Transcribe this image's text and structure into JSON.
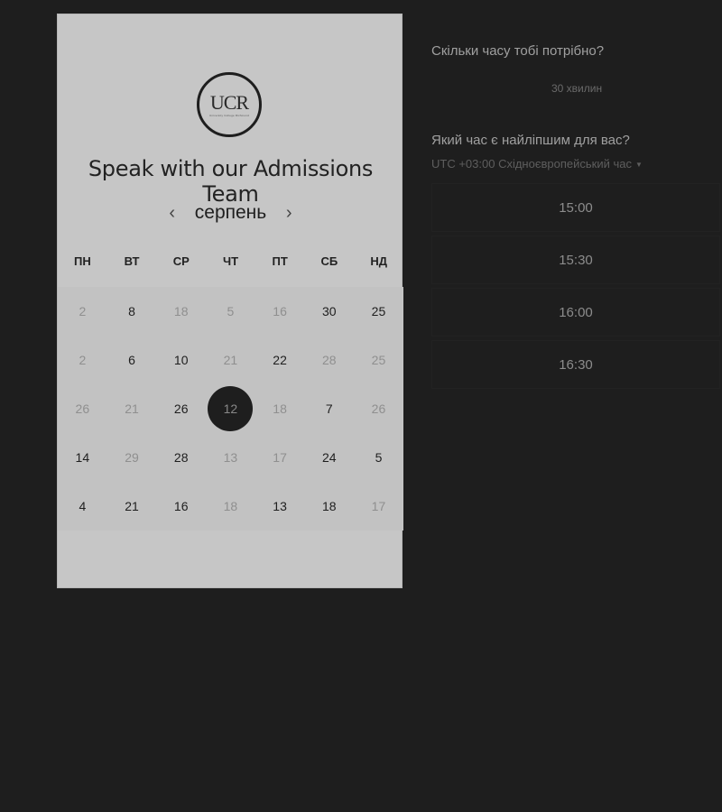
{
  "logo": {
    "mark": "UCR",
    "subtitle": "University College Richmond"
  },
  "title": "Speak with our Admissions Team",
  "calendar": {
    "month": "серпень",
    "prev_icon": "chevron-left-icon",
    "next_icon": "chevron-right-icon",
    "weekdays": [
      "ПН",
      "ВТ",
      "СР",
      "ЧТ",
      "ПТ",
      "СБ",
      "НД"
    ],
    "days": [
      {
        "label": "2",
        "available": false
      },
      {
        "label": "8",
        "available": true
      },
      {
        "label": "18",
        "available": false
      },
      {
        "label": "5",
        "available": false
      },
      {
        "label": "16",
        "available": false
      },
      {
        "label": "30",
        "available": true
      },
      {
        "label": "25",
        "available": true
      },
      {
        "label": "2",
        "available": false
      },
      {
        "label": "6",
        "available": true
      },
      {
        "label": "10",
        "available": true
      },
      {
        "label": "21",
        "available": false
      },
      {
        "label": "22",
        "available": true
      },
      {
        "label": "28",
        "available": false
      },
      {
        "label": "25",
        "available": false
      },
      {
        "label": "26",
        "available": false
      },
      {
        "label": "21",
        "available": false
      },
      {
        "label": "26",
        "available": true
      },
      {
        "label": "12",
        "available": true,
        "selected": true
      },
      {
        "label": "18",
        "available": false
      },
      {
        "label": "7",
        "available": true
      },
      {
        "label": "26",
        "available": false
      },
      {
        "label": "14",
        "available": true
      },
      {
        "label": "29",
        "available": false
      },
      {
        "label": "28",
        "available": true
      },
      {
        "label": "13",
        "available": false
      },
      {
        "label": "17",
        "available": false
      },
      {
        "label": "24",
        "available": true
      },
      {
        "label": "5",
        "available": true
      },
      {
        "label": "4",
        "available": true
      },
      {
        "label": "21",
        "available": true
      },
      {
        "label": "16",
        "available": true
      },
      {
        "label": "18",
        "available": false
      },
      {
        "label": "13",
        "available": true
      },
      {
        "label": "18",
        "available": true
      },
      {
        "label": "17",
        "available": false
      }
    ]
  },
  "duration": {
    "question": "Скільки часу тобі потрібно?",
    "value": "30 хвилин"
  },
  "time": {
    "question": "Який час є найліпшим для вас?",
    "timezone": "UTC +03:00 Східноєвропейський час",
    "slots": [
      "15:00",
      "15:30",
      "16:00",
      "16:30"
    ]
  }
}
